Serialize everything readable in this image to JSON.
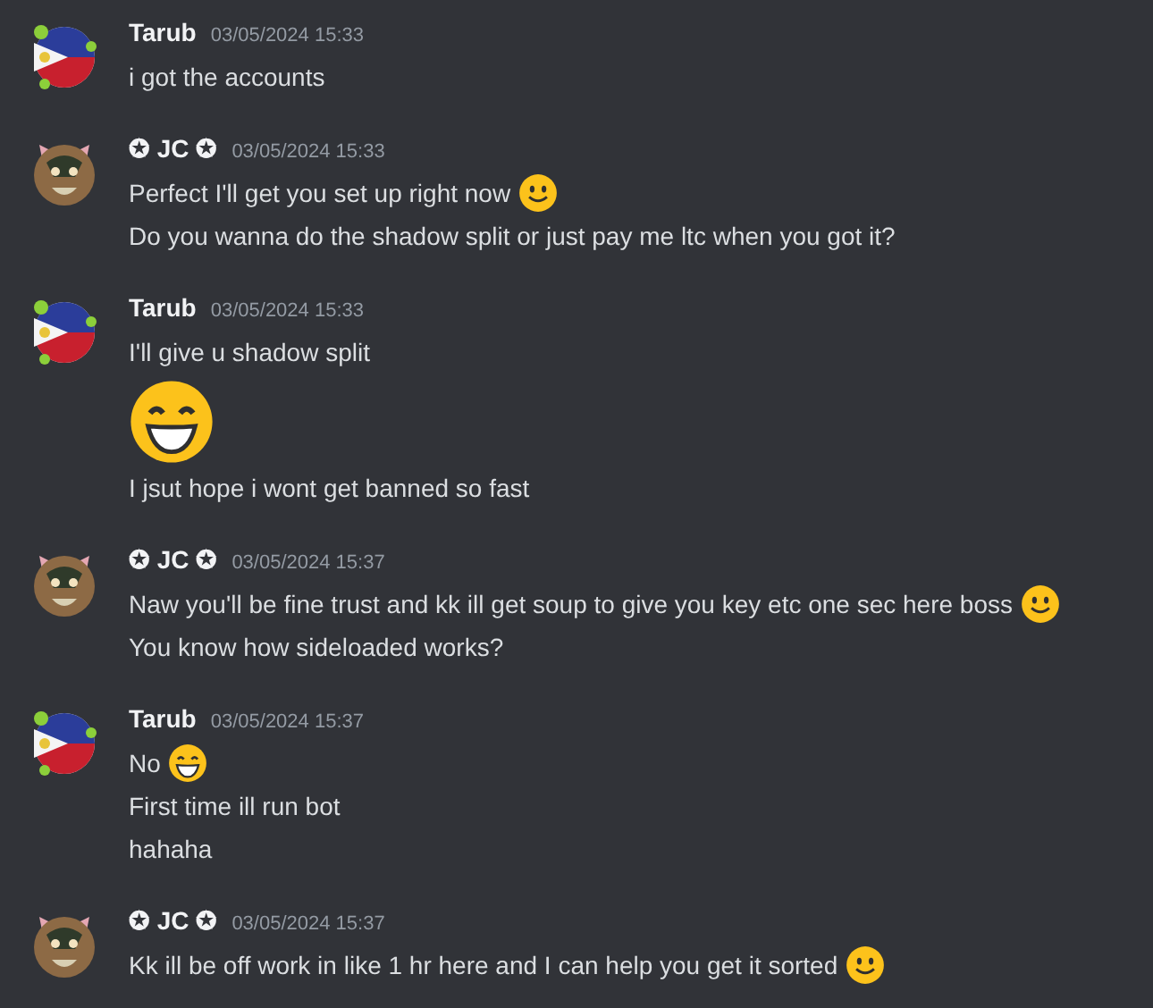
{
  "messages": [
    {
      "author": "Tarub",
      "avatar": {
        "kind": "flag"
      },
      "timestamp": "03/05/2024 15:33",
      "lines": [
        {
          "kind": "text",
          "text": "i got the accounts"
        }
      ]
    },
    {
      "author": "✪ JC ✪",
      "avatar": {
        "kind": "cat"
      },
      "timestamp": "03/05/2024 15:33",
      "lines": [
        {
          "kind": "text",
          "text": "Perfect I'll get you set up right now",
          "emoji": {
            "kind": "smile"
          }
        },
        {
          "kind": "text",
          "text": "Do you wanna do the shadow split or just pay me ltc when you got it?"
        }
      ]
    },
    {
      "author": "Tarub",
      "avatar": {
        "kind": "flag"
      },
      "timestamp": "03/05/2024 15:33",
      "lines": [
        {
          "kind": "text",
          "text": "I'll give u shadow split"
        },
        {
          "kind": "jumbo",
          "emoji": {
            "kind": "grin"
          }
        },
        {
          "kind": "text",
          "text": "I jsut hope i wont get banned so fast"
        }
      ]
    },
    {
      "author": "✪ JC ✪",
      "avatar": {
        "kind": "cat"
      },
      "timestamp": "03/05/2024 15:37",
      "lines": [
        {
          "kind": "text",
          "text": "Naw you'll be fine trust and kk ill get soup to give you key etc one sec here boss",
          "emoji": {
            "kind": "smile"
          }
        },
        {
          "kind": "text",
          "text": "You know how sideloaded works?"
        }
      ]
    },
    {
      "author": "Tarub",
      "avatar": {
        "kind": "flag"
      },
      "timestamp": "03/05/2024 15:37",
      "lines": [
        {
          "kind": "text",
          "text": "No",
          "emoji": {
            "kind": "grin"
          }
        },
        {
          "kind": "text",
          "text": "First time ill run bot"
        },
        {
          "kind": "text",
          "text": "hahaha"
        }
      ]
    },
    {
      "author": "✪ JC ✪",
      "avatar": {
        "kind": "cat"
      },
      "timestamp": "03/05/2024 15:37",
      "lines": [
        {
          "kind": "text",
          "text": "Kk ill be off work in like 1 hr here and I can help you get it sorted",
          "emoji": {
            "kind": "smile"
          }
        }
      ]
    }
  ]
}
